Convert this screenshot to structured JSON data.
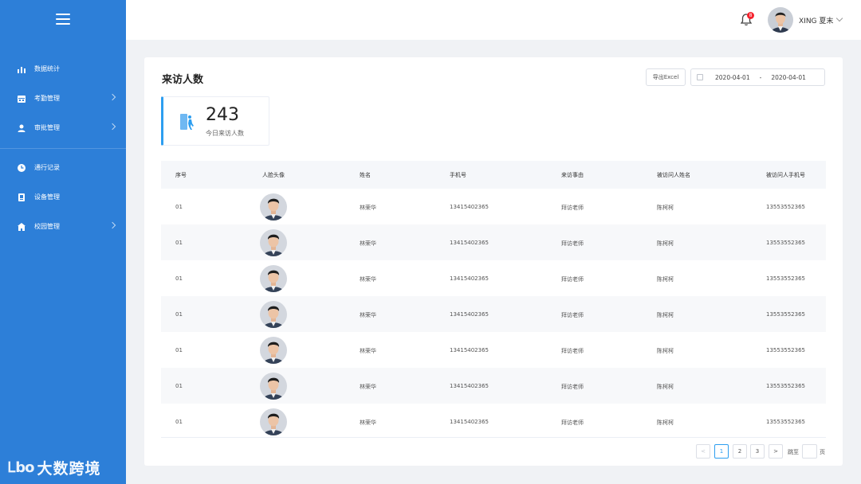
{
  "sidebar": {
    "items_top": [
      {
        "label": "数据统计",
        "icon": "bar-chart-icon",
        "has_children": false
      },
      {
        "label": "考勤管理",
        "icon": "calendar-icon",
        "has_children": true
      },
      {
        "label": "审批管理",
        "icon": "user-icon",
        "has_children": true
      }
    ],
    "items_bottom": [
      {
        "label": "通行记录",
        "icon": "clock-icon",
        "has_children": false
      },
      {
        "label": "设备管理",
        "icon": "device-icon",
        "has_children": false
      },
      {
        "label": "校园管理",
        "icon": "school-icon",
        "has_children": true
      }
    ],
    "brand_mark": "Ꮮbo",
    "brand_text": "大数跨境"
  },
  "topbar": {
    "notification_count": "8",
    "user_name": "XING 夏末"
  },
  "page": {
    "title": "来访人数",
    "export_label": "导出Excel",
    "date_start": "2020-04-01",
    "date_separator": "-",
    "date_end": "2020-04-01"
  },
  "stat": {
    "value": "243",
    "label": "今日来访人数"
  },
  "table": {
    "columns": [
      "序号",
      "人脸头像",
      "姓名",
      "手机号",
      "来访事由",
      "被访问人姓名",
      "被访问人手机号"
    ],
    "rows": [
      {
        "index": "01",
        "name": "林荣华",
        "phone": "13415402365",
        "reason": "拜访老师",
        "visited_name": "陈柯柯",
        "visited_phone": "13553552365"
      },
      {
        "index": "01",
        "name": "林荣华",
        "phone": "13415402365",
        "reason": "拜访老师",
        "visited_name": "陈柯柯",
        "visited_phone": "13553552365"
      },
      {
        "index": "01",
        "name": "林荣华",
        "phone": "13415402365",
        "reason": "拜访老师",
        "visited_name": "陈柯柯",
        "visited_phone": "13553552365"
      },
      {
        "index": "01",
        "name": "林荣华",
        "phone": "13415402365",
        "reason": "拜访老师",
        "visited_name": "陈柯柯",
        "visited_phone": "13553552365"
      },
      {
        "index": "01",
        "name": "林荣华",
        "phone": "13415402365",
        "reason": "拜访老师",
        "visited_name": "陈柯柯",
        "visited_phone": "13553552365"
      },
      {
        "index": "01",
        "name": "林荣华",
        "phone": "13415402365",
        "reason": "拜访老师",
        "visited_name": "陈柯柯",
        "visited_phone": "13553552365"
      },
      {
        "index": "01",
        "name": "林荣华",
        "phone": "13415402365",
        "reason": "拜访老师",
        "visited_name": "陈柯柯",
        "visited_phone": "13553552365"
      }
    ]
  },
  "pagination": {
    "prev": "<",
    "pages": [
      "1",
      "2",
      "3"
    ],
    "current": "1",
    "next": ">",
    "jump_label": "跳至",
    "page_unit": "页"
  },
  "colors": {
    "sidebar": "#2d7fd8",
    "accent": "#2d9ef0",
    "badge": "#f5222d"
  }
}
